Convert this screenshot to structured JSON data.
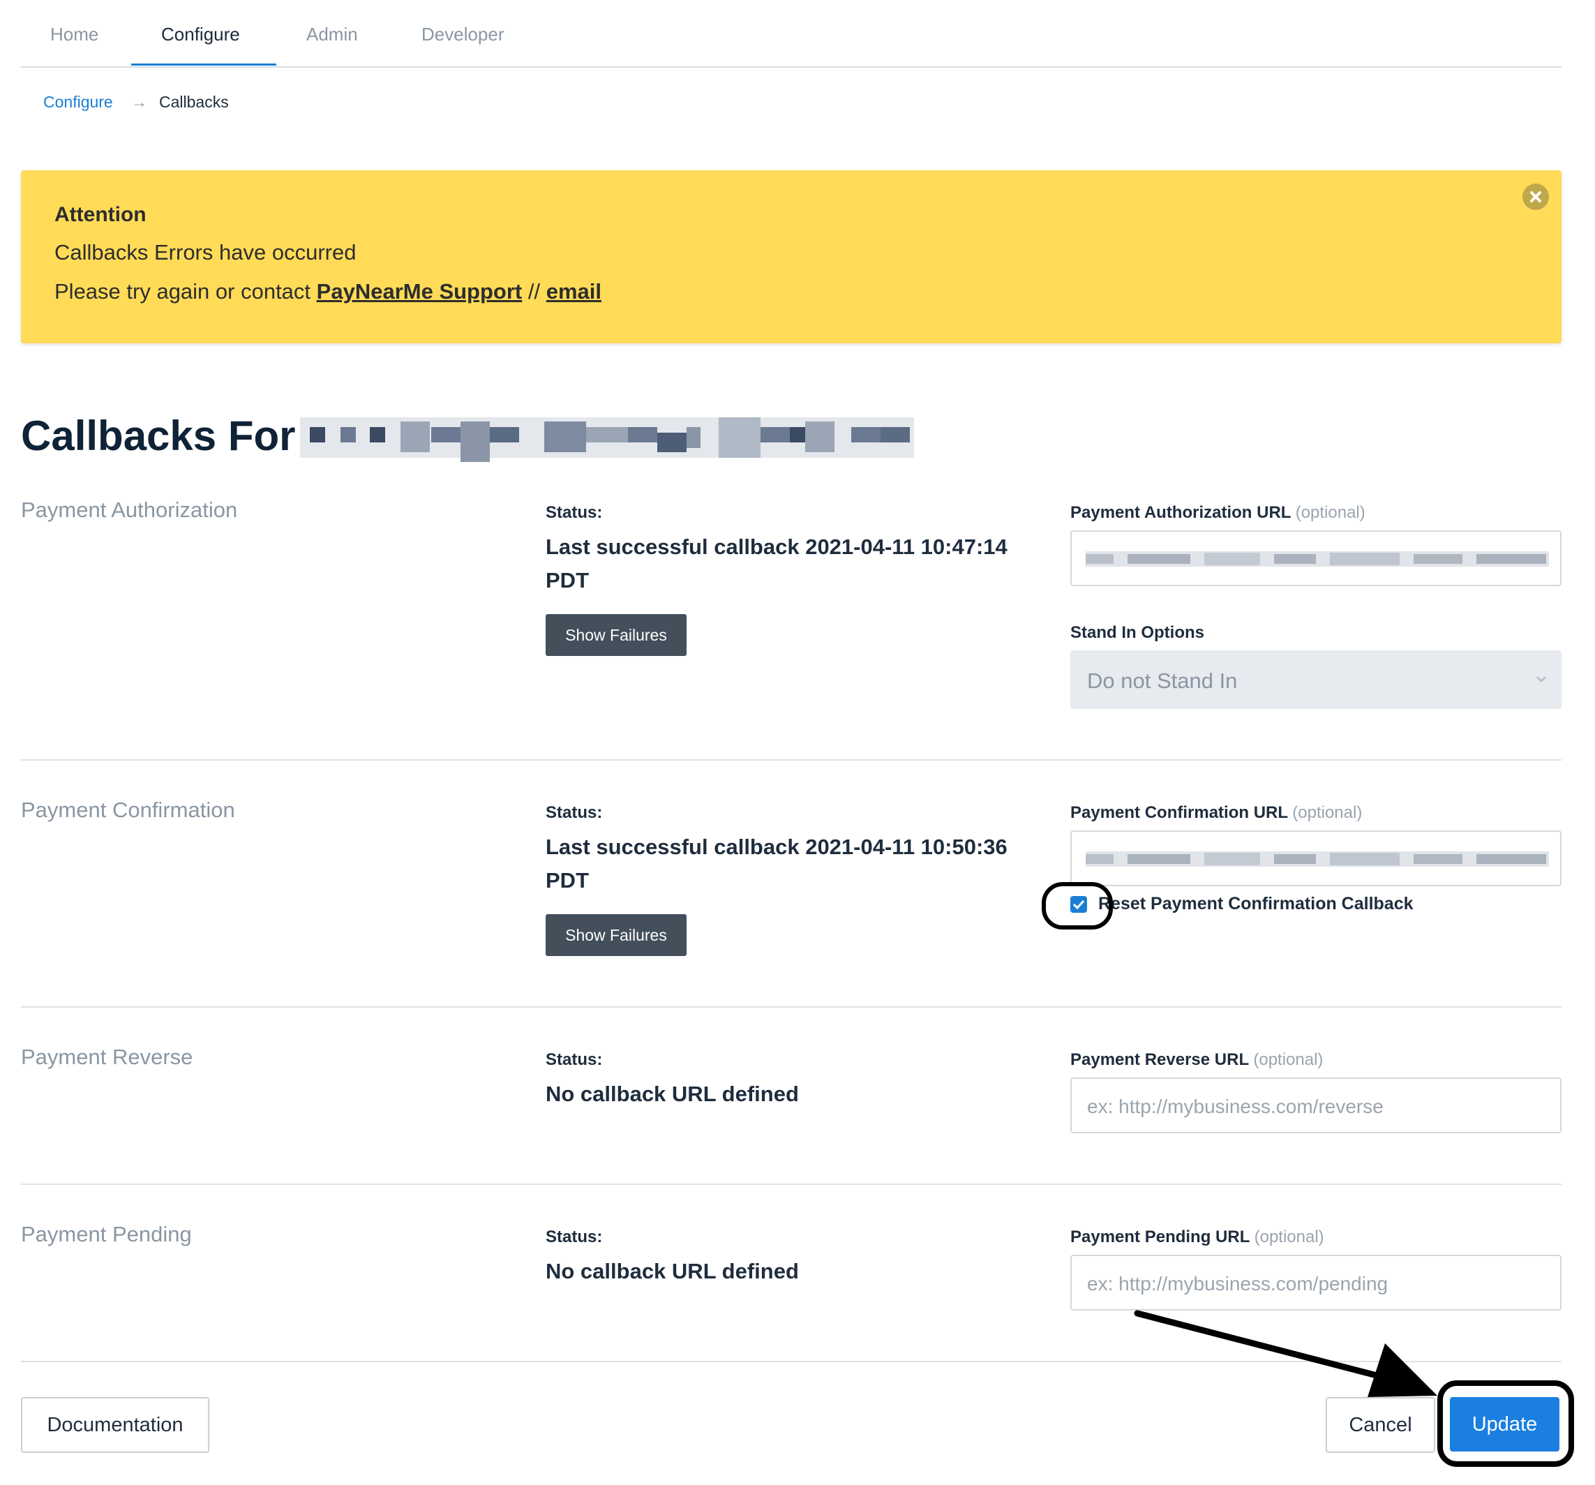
{
  "nav": {
    "tabs": [
      "Home",
      "Configure",
      "Admin",
      "Developer"
    ],
    "active": "Configure"
  },
  "breadcrumb": {
    "parent": "Configure",
    "arrow": "→",
    "current": "Callbacks"
  },
  "alert": {
    "title": "Attention",
    "message": "Callbacks Errors have occurred",
    "contact_prefix": "Please try again or contact",
    "support_link": "PayNearMe Support",
    "separator": "//",
    "email_link": "email",
    "background": "#ffdb57"
  },
  "page": {
    "title": "Callbacks For"
  },
  "sections": [
    {
      "label": "Payment Authorization",
      "status_label": "Status:",
      "status_text": "Last successful callback 2021-04-11 10:47:14 PDT",
      "failures_button": "Show Failures",
      "url_label": "Payment Authorization URL",
      "optional": "(optional)",
      "stand_in_label": "Stand In Options",
      "stand_in_value": "Do not Stand In"
    },
    {
      "label": "Payment Confirmation",
      "status_label": "Status:",
      "status_text": "Last successful callback 2021-04-11 10:50:36 PDT",
      "failures_button": "Show Failures",
      "url_label": "Payment Confirmation URL",
      "optional": "(optional)",
      "reset_label": "Reset Payment Confirmation Callback",
      "reset_checked": true
    },
    {
      "label": "Payment Reverse",
      "status_label": "Status:",
      "status_text": "No callback URL defined",
      "url_label": "Payment Reverse URL",
      "optional": "(optional)",
      "placeholder": "ex:  http://mybusiness.com/reverse"
    },
    {
      "label": "Payment Pending",
      "status_label": "Status:",
      "status_text": "No callback URL defined",
      "url_label": "Payment Pending URL",
      "optional": "(optional)",
      "placeholder": "ex:  http://mybusiness.com/pending"
    }
  ],
  "footer": {
    "documentation": "Documentation",
    "cancel": "Cancel",
    "update": "Update"
  },
  "colors": {
    "accent": "#1a7fd4",
    "primary_button": "#1a7fe0",
    "dark_button": "#434f5b"
  },
  "icons": [
    "close-icon",
    "chevron-down-icon",
    "checkmark-icon",
    "arrow-annotation-icon"
  ]
}
